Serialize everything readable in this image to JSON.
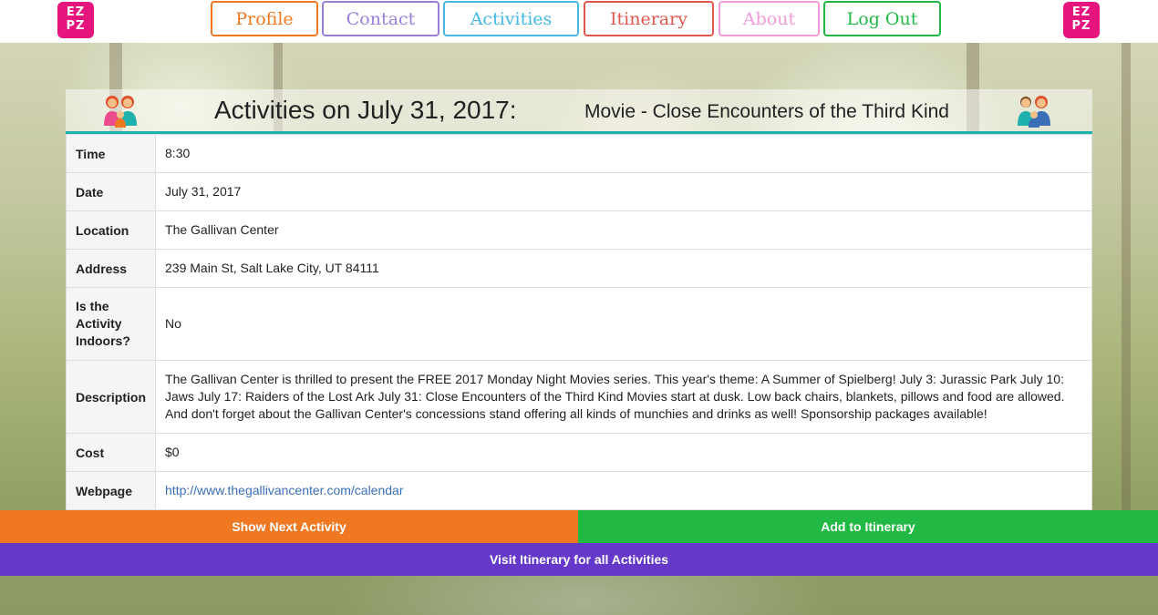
{
  "nav": {
    "logo_text": [
      "EZ",
      "PZ"
    ],
    "items": [
      {
        "label": "Profile",
        "color": "#f07822"
      },
      {
        "label": "Contact",
        "color": "#9a7fd9"
      },
      {
        "label": "Activities",
        "color": "#45b8e6"
      },
      {
        "label": "Itinerary",
        "color": "#e0574f"
      },
      {
        "label": "About",
        "color": "#f29ad8"
      },
      {
        "label": "Log Out",
        "color": "#21b843"
      }
    ]
  },
  "heading": {
    "date_title": "Activities on July 31, 2017:",
    "activity_title": "Movie - Close Encounters of the Third Kind",
    "left_icon": "family-mother-children-icon",
    "right_icon": "family-father-children-icon"
  },
  "details": {
    "time": {
      "label": "Time",
      "value": "8:30"
    },
    "date": {
      "label": "Date",
      "value": "July 31, 2017"
    },
    "location": {
      "label": "Location",
      "value": "The Gallivan Center"
    },
    "address": {
      "label": "Address",
      "value": "239 Main St, Salt Lake City, UT 84111"
    },
    "indoors": {
      "label": "Is the Activity Indoors?",
      "value": "No"
    },
    "description": {
      "label": "Description",
      "value": "The Gallivan Center is thrilled to present the FREE 2017 Monday Night Movies series. This year's theme: A Summer of Spielberg! July 3: Jurassic Park July 10: Jaws July 17: Raiders of the Lost Ark July 31: Close Encounters of the Third Kind Movies start at dusk. Low back chairs, blankets, pillows and food are allowed. And don't forget about the Gallivan Center's concessions stand offering all kinds of munchies and drinks as well! Sponsorship packages available!"
    },
    "cost": {
      "label": "Cost",
      "value": "$0"
    },
    "webpage": {
      "label": "Webpage",
      "value": "http://www.thegallivancenter.com/calendar"
    }
  },
  "actions": {
    "next_label": "Show Next Activity",
    "add_label": "Add to Itinerary",
    "visit_label": "Visit Itinerary for all Activities"
  },
  "colors": {
    "brand_pink": "#e6157e",
    "accent_teal": "#1fb2ad",
    "next_orange": "#f07822",
    "add_green": "#21b843",
    "visit_purple": "#6638c9",
    "link_blue": "#3a6fb7"
  }
}
